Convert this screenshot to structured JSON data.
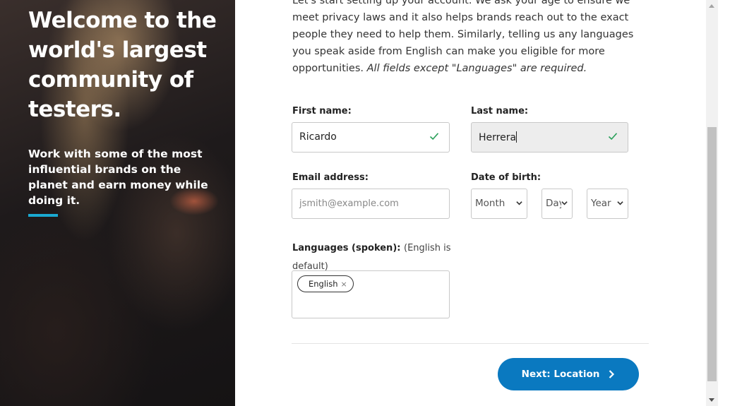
{
  "hero": {
    "title": "Welcome to the world's largest community of testers.",
    "subtitle": "Work with some of the most influential brands on the planet and earn money while doing it.",
    "accent_color": "#1aa9d1"
  },
  "intro": {
    "text": "Let's start setting up your account. We ask your age to ensure we meet privacy laws and it also helps brands reach out to the exact people they need to help them. Similarly, telling us any languages you speak aside from English can make you eligible for more opportunities.",
    "note": "All fields except \"Languages\" are required."
  },
  "form": {
    "first_name": {
      "label": "First name:",
      "value": "Ricardo",
      "valid_icon": "check-icon"
    },
    "last_name": {
      "label": "Last name:",
      "value": "Herrera",
      "valid_icon": "check-icon"
    },
    "email": {
      "label": "Email address:",
      "value": "",
      "placeholder": "jsmith@example.com"
    },
    "dob": {
      "label": "Date of birth:",
      "month": "Month",
      "day": "Day",
      "year": "Year"
    },
    "languages": {
      "label": "Languages (spoken):",
      "hint": "(English is default)",
      "tags": [
        "English"
      ],
      "remove_glyph": "×"
    }
  },
  "actions": {
    "next_label": "Next: Location",
    "next_color": "#0a79c0",
    "arrow_icon": "chevron-right-icon"
  },
  "colors": {
    "valid": "#2aa05a"
  }
}
